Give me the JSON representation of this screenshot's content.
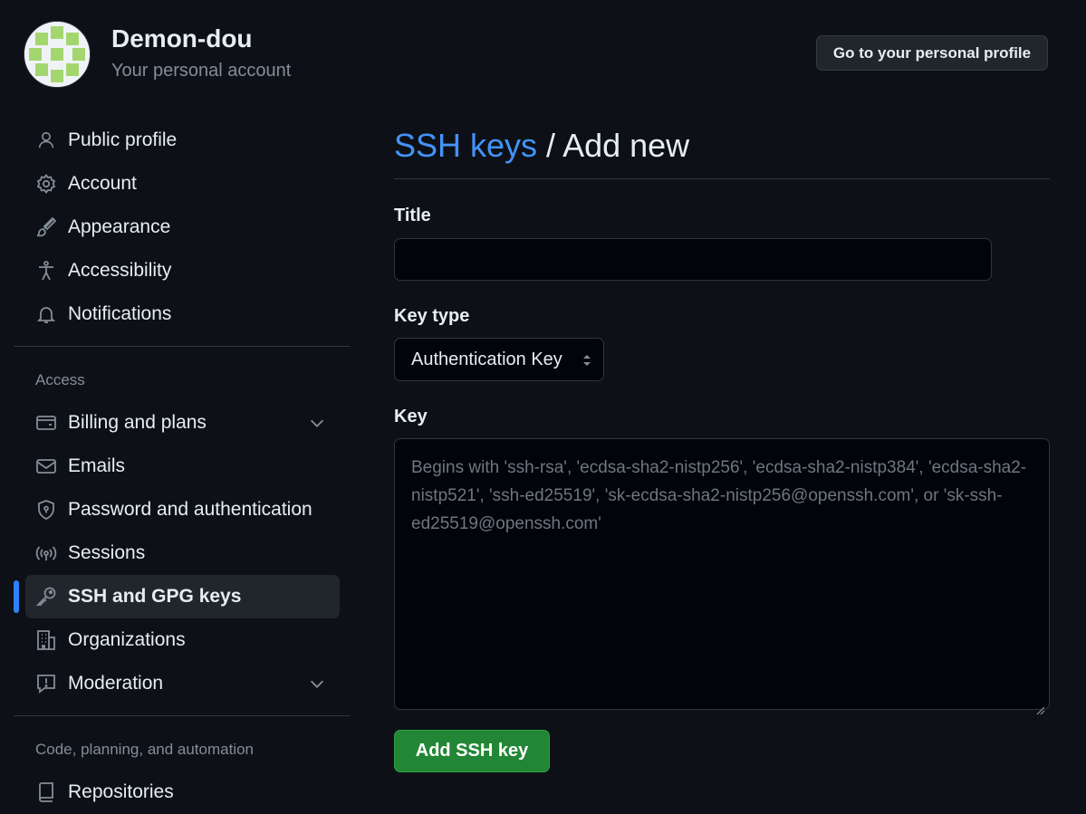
{
  "account": {
    "name": "Demon-dou",
    "subtitle": "Your personal account",
    "profile_button": "Go to your personal profile"
  },
  "sidebar": {
    "items": [
      {
        "label": "Public profile",
        "icon": "person-icon"
      },
      {
        "label": "Account",
        "icon": "gear-icon"
      },
      {
        "label": "Appearance",
        "icon": "paintbrush-icon"
      },
      {
        "label": "Accessibility",
        "icon": "accessibility-icon"
      },
      {
        "label": "Notifications",
        "icon": "bell-icon"
      }
    ],
    "access_label": "Access",
    "access_items": [
      {
        "label": "Billing and plans",
        "icon": "credit-card-icon",
        "expandable": true
      },
      {
        "label": "Emails",
        "icon": "mail-icon"
      },
      {
        "label": "Password and authentication",
        "icon": "shield-lock-icon"
      },
      {
        "label": "Sessions",
        "icon": "broadcast-icon"
      },
      {
        "label": "SSH and GPG keys",
        "icon": "key-icon",
        "active": true
      },
      {
        "label": "Organizations",
        "icon": "organization-icon"
      },
      {
        "label": "Moderation",
        "icon": "report-icon",
        "expandable": true
      }
    ],
    "code_label": "Code, planning, and automation",
    "code_items": [
      {
        "label": "Repositories",
        "icon": "repo-icon"
      }
    ]
  },
  "main": {
    "breadcrumb_link": "SSH keys",
    "breadcrumb_sep": " / ",
    "breadcrumb_current": "Add new",
    "title_label": "Title",
    "title_value": "",
    "key_type_label": "Key type",
    "key_type_value": "Authentication Key",
    "key_label": "Key",
    "key_placeholder": "Begins with 'ssh-rsa', 'ecdsa-sha2-nistp256', 'ecdsa-sha2-nistp384', 'ecdsa-sha2-nistp521', 'ssh-ed25519', 'sk-ecdsa-sha2-nistp256@openssh.com', or 'sk-ssh-ed25519@openssh.com'",
    "submit_label": "Add SSH key"
  },
  "colors": {
    "background": "#0d1117",
    "link": "#4493f8",
    "active_indicator": "#2f81f7",
    "primary_button": "#238636"
  }
}
